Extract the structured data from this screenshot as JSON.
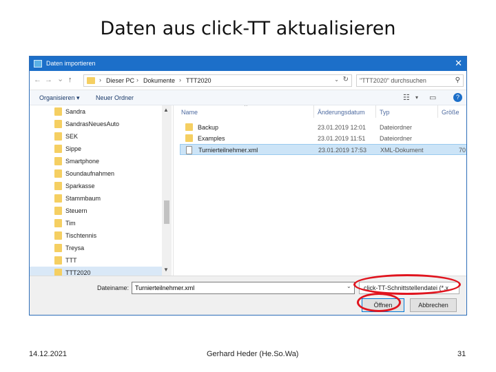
{
  "slide": {
    "title": "Daten aus click-TT aktualisieren",
    "footer_date": "14.12.2021",
    "footer_author": "Gerhard Heder (He.So.Wa)",
    "page_number": "31"
  },
  "dialog": {
    "title": "Daten importieren",
    "close_glyph": "✕",
    "address": {
      "back": "←",
      "forward": "→",
      "down": "⌄",
      "up": "↑",
      "crumbs": [
        "Dieser PC",
        "Dokumente",
        "TTT2020"
      ],
      "search_placeholder": "\"TTT2020\" durchsuchen",
      "search_icon": "search-icon"
    },
    "toolbar": {
      "organize": "Organisieren ▾",
      "new_folder": "Neuer Ordner"
    },
    "nav_items": [
      {
        "label": "Sandra"
      },
      {
        "label": "SandrasNeuesAuto"
      },
      {
        "label": "SEK"
      },
      {
        "label": "Sippe"
      },
      {
        "label": "Smartphone"
      },
      {
        "label": "Soundaufnahmen"
      },
      {
        "label": "Sparkasse"
      },
      {
        "label": "Stammbaum"
      },
      {
        "label": "Steuern"
      },
      {
        "label": "Tim"
      },
      {
        "label": "Tischtennis"
      },
      {
        "label": "Treysa"
      },
      {
        "label": "TTT"
      },
      {
        "label": "TTT2020",
        "selected": true
      }
    ],
    "columns": {
      "name": "Name",
      "date": "Änderungsdatum",
      "type": "Typ",
      "size": "Größe"
    },
    "files": [
      {
        "name": "Backup",
        "date": "23.01.2019 12:01",
        "type": "Dateiordner",
        "size": "",
        "icon": "folder-icon"
      },
      {
        "name": "Examples",
        "date": "23.01.2019 11:51",
        "type": "Dateiordner",
        "size": "",
        "icon": "folder-icon"
      },
      {
        "name": "Turnierteilnehmer.xml",
        "date": "23.01.2019 17:53",
        "type": "XML-Dokument",
        "size": "70",
        "icon": "document-icon",
        "selected": true
      }
    ],
    "filename_label": "Dateiname:",
    "filename_value": "Turnierteilnehmer.xml",
    "filetype_value": "click-TT-Schnittstellendatei (*.x",
    "open_button": "Öffnen",
    "cancel_button": "Abbrechen"
  },
  "annotations": {
    "ring_color": "#e0141e"
  }
}
